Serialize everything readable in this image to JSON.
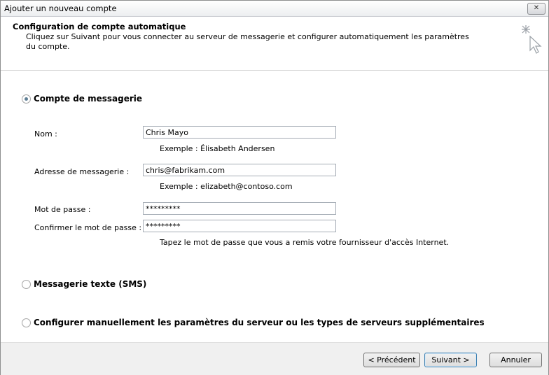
{
  "window": {
    "title": "Ajouter un nouveau compte",
    "close_label": "✕"
  },
  "header": {
    "title": "Configuration de compte automatique",
    "description": "Cliquez sur Suivant pour vous connecter au serveur de messagerie et configurer automatiquement les paramètres du compte."
  },
  "options": {
    "email_account": {
      "label": "Compte de messagerie",
      "selected": true
    },
    "sms": {
      "label": "Messagerie texte (SMS)",
      "selected": false
    },
    "manual": {
      "label": "Configurer manuellement les paramètres du serveur ou les types de serveurs supplémentaires",
      "selected": false
    }
  },
  "fields": {
    "name": {
      "label": "Nom :",
      "value": "Chris Mayo",
      "example": "Exemple : Élisabeth Andersen"
    },
    "email": {
      "label": "Adresse de messagerie :",
      "value": "chris@fabrikam.com",
      "example": "Exemple : elizabeth@contoso.com"
    },
    "password": {
      "label": "Mot de passe :",
      "value": "*********"
    },
    "confirm": {
      "label": "Confirmer le mot de passe :",
      "value": "*********",
      "hint": "Tapez le mot de passe que vous a remis votre fournisseur d'accès Internet."
    }
  },
  "buttons": {
    "back": "< Précédent",
    "next": "Suivant >",
    "cancel": "Annuler"
  }
}
